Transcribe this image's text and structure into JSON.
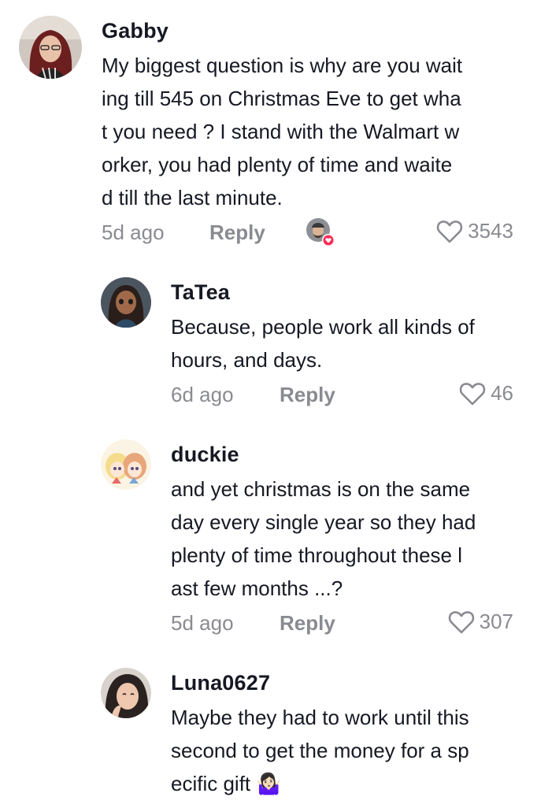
{
  "colors": {
    "text_primary": "#161823",
    "text_secondary": "#8a8b91",
    "like_badge": "#fe2c55"
  },
  "comments": [
    {
      "username": "Gabby",
      "text": "My biggest question is why are you wait\ning till 545 on Christmas Eve to get wha\nt you need ? I stand with the Walmart w\norker, you had plenty of time and waite\nd till the last minute.",
      "time": "5d ago",
      "reply_label": "Reply",
      "likes": "3543",
      "creator_liked": true,
      "avatar_icon": "user-avatar"
    },
    {
      "username": "TaTea",
      "text": "Because, people work all kinds of\nhours, and days.",
      "time": "6d ago",
      "reply_label": "Reply",
      "likes": "46",
      "avatar_icon": "user-avatar"
    },
    {
      "username": "duckie",
      "text": "and yet christmas is on the same\nday every single year so they had\nplenty of time throughout these l\nast few months ...?",
      "time": "5d ago",
      "reply_label": "Reply",
      "likes": "307",
      "avatar_icon": "user-avatar"
    },
    {
      "username": "Luna0627",
      "text": "Maybe they had to work until this\nsecond to get the money for a sp\necific gift 🤷🏻‍♀️",
      "avatar_icon": "user-avatar"
    }
  ]
}
